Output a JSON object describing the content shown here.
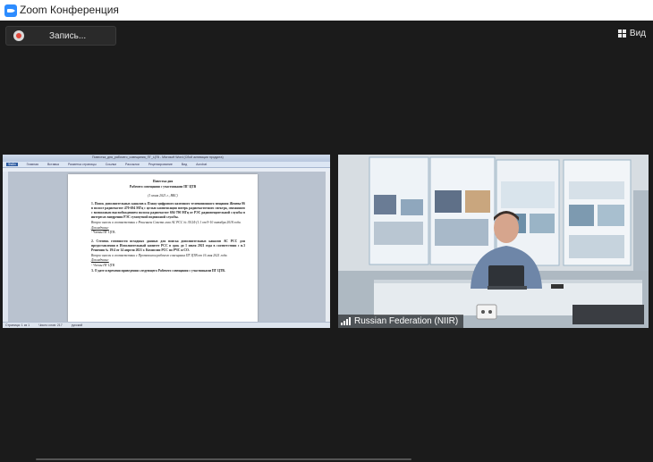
{
  "window": {
    "title": "Zoom Конференция"
  },
  "toolbar": {
    "record_label": "Запись...",
    "view_label": "Вид"
  },
  "shared_document": {
    "window_title": "Повестка_дня_рабочего_совещания_ПГ_ЦТВ - Microsoft Word (Сбой активации продукта)",
    "ribbon_tabs": [
      "Файл",
      "Главная",
      "Вставка",
      "Разметка страницы",
      "Ссылки",
      "Рассылки",
      "Рецензирование",
      "Вид",
      "Acrobat"
    ],
    "heading_1": "Повестка дня",
    "heading_2": "Рабочего совещания с участниками ПГ ЦТВ",
    "date": "(1 июня 2021 г., ВКС)",
    "item_1": "1. Поиск дополнительных каналов к Плану цифрового наземного телевизионного вещания Женева 06 в полосе радиочастот 470-694 МГц с целью компенсации потерь радиочастотного спектра, связанного с возможным высвобождением полосы радиочастот 694-790 МГц от РЭС радиовещательной службы в интересах внедрения РЭС сухопутной подвижной службы.",
    "item_1_note": "Вопрос внесен в соответствии с Решением Совета глав АС РСС № 35/24-(1.1 от 9-10 октября 2018 года.",
    "item_1_speakers_label": "Докладчики:",
    "item_1_speakers": "- Члены ПГ ЦТВ.",
    "item_2": "2. Степень готовности исходных данных для поиска дополнительных каналов АС РСС для предоставления в Исполнительный комитет РСС в срок до 1 июля 2021 года в соответствии с п.3 Решения № 19/4 от 14 апреля 2021 г. Комиссии РСС по РЧС и СО.",
    "item_2_note": "Вопрос внесен в соответствии с Протоколом рабочего совещания ПГ ЦТВ от 16 мая 2021 года.",
    "item_2_speakers_label": "Докладчики:",
    "item_2_speakers": "- Члены ПГ ЦТВ",
    "item_3": "3. О дате и времени проведения следующего Рабочего совещания с участниками ПГ ЦТВ.",
    "status_left": "Страница: 1 из 1",
    "status_words": "Число слов: 217",
    "status_lang": "русский"
  },
  "video": {
    "participant_name": "Russian Federation (NIIR)"
  },
  "colors": {
    "accent": "#2d8cff",
    "background": "#1b1b1b",
    "record": "#e0473a"
  },
  "icons": {
    "app": "zoom-icon",
    "record": "record-icon",
    "view": "grid-view-icon",
    "signal": "signal-strength-icon"
  }
}
